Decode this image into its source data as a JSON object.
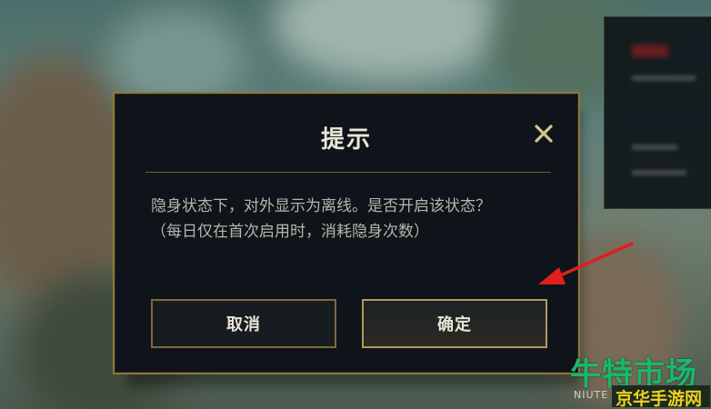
{
  "dialog": {
    "title": "提示",
    "message_line1": "隐身状态下，对外显示为离线。是否开启该状态？",
    "message_line2": "（每日仅在首次启用时，消耗隐身次数）",
    "cancel_label": "取消",
    "confirm_label": "确定"
  },
  "icons": {
    "close": "close-icon",
    "annotation": "red-arrow-icon"
  },
  "watermark": {
    "main": "牛特市场",
    "sub": "京华手游网",
    "small": "NIUTE"
  },
  "colors": {
    "accent_gold": "#8f7740",
    "dialog_bg": "#0e1419",
    "close_icon": "#d9c48a",
    "arrow_red": "#e01e1e",
    "watermark_green": "#18b86a",
    "watermark_yellow": "#f0d21a"
  }
}
